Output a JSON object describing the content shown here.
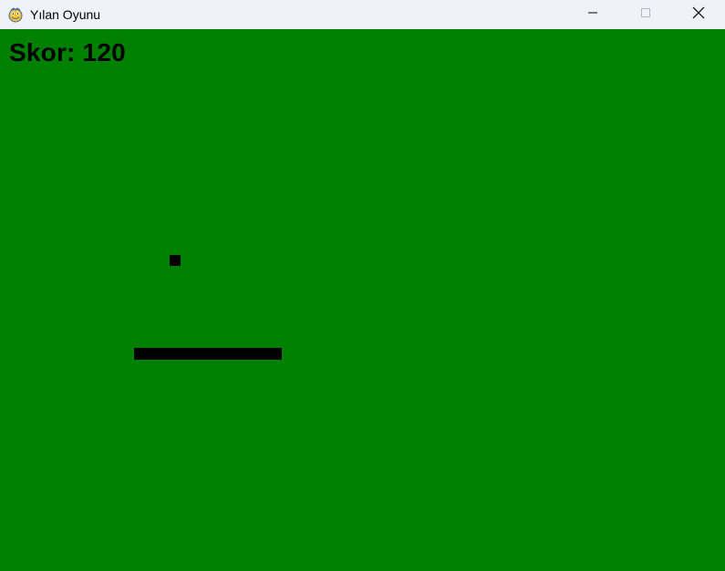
{
  "window": {
    "title": "Yılan Oyunu",
    "icon": "pygame-snake-icon"
  },
  "controls": {
    "minimize_icon": "minimize-icon",
    "maximize_icon": "maximize-icon",
    "close_icon": "close-icon"
  },
  "game": {
    "background_color": "#008000",
    "score_text": "Skor: 120",
    "snake_color": "#000000",
    "food_color": "#000000"
  }
}
